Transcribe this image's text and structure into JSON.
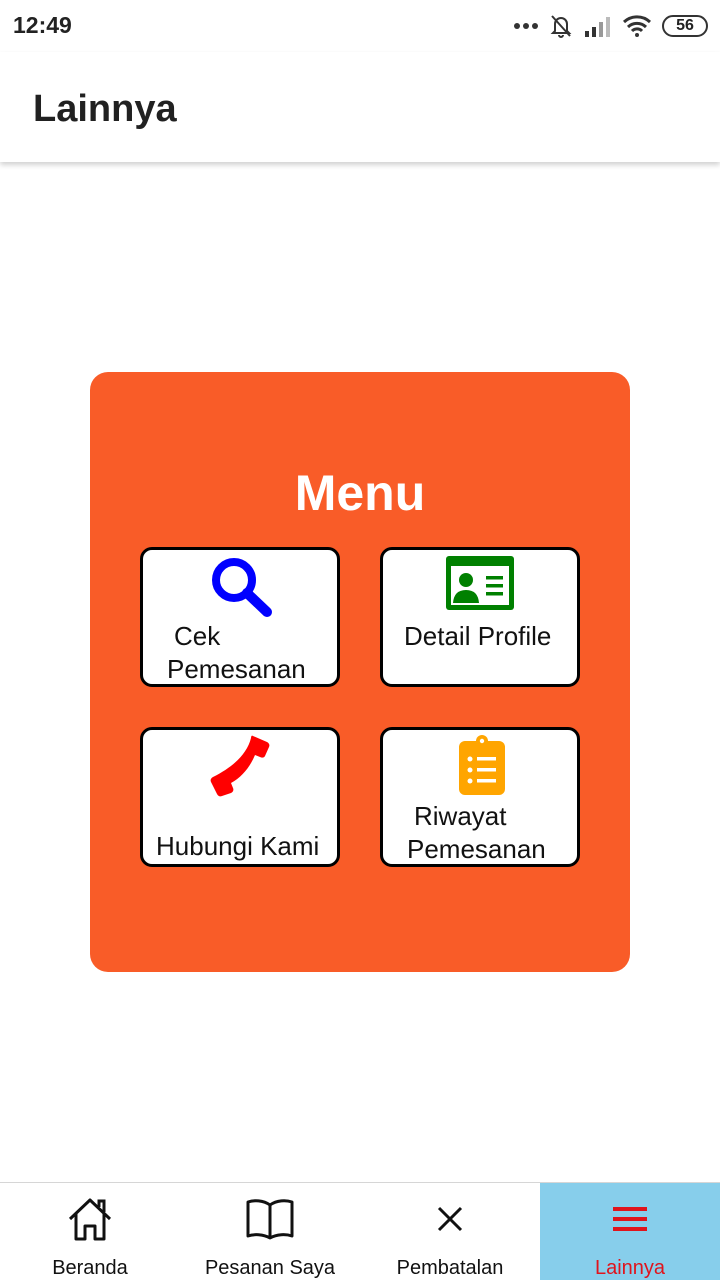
{
  "status_bar": {
    "time": "12:49",
    "battery": "56",
    "icons": [
      "more-dots-icon",
      "notifications-off-icon",
      "signal-icon",
      "wifi-icon",
      "battery-icon"
    ]
  },
  "app_bar": {
    "title": "Lainnya"
  },
  "menu": {
    "heading": "Menu",
    "background_color": "#f95c28",
    "tiles": [
      {
        "line1": "Cek",
        "line2": "Pemesanan",
        "icon": "search-icon",
        "icon_color": "#0000ff"
      },
      {
        "line1": "Detail Profile",
        "icon": "profile-card-icon",
        "icon_color": "#008000"
      },
      {
        "line1": "Hubungi Kami",
        "icon": "phone-icon",
        "icon_color": "#ff0000"
      },
      {
        "line1": "Riwayat",
        "line2": "Pemesanan",
        "icon": "clipboard-list-icon",
        "icon_color": "#ffa500"
      }
    ]
  },
  "bottom_nav": {
    "active_background": "#87ceeb",
    "active_color": "#e0141c",
    "items": [
      {
        "label": "Beranda",
        "icon": "home-icon"
      },
      {
        "label": "Pesanan Saya",
        "icon": "book-icon"
      },
      {
        "label": "Pembatalan",
        "icon": "close-icon"
      },
      {
        "label": "Lainnya",
        "icon": "menu-icon",
        "active": true
      }
    ]
  }
}
